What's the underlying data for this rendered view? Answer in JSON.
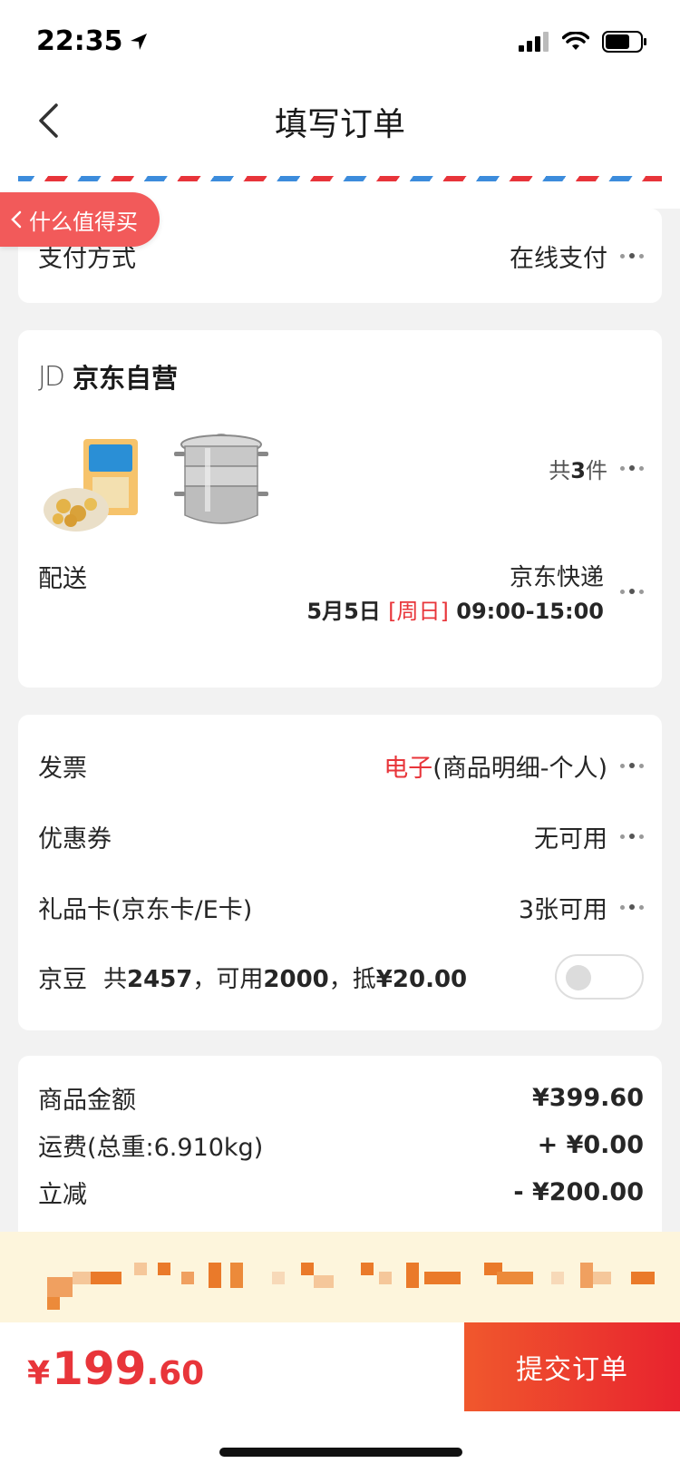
{
  "status_bar": {
    "time": "22:35"
  },
  "nav": {
    "title": "填写订单"
  },
  "floating_pill": {
    "label": "什么值得买"
  },
  "payment": {
    "label": "支付方式",
    "value": "在线支付"
  },
  "shop": {
    "logo_text": "JD",
    "name": "京东自营",
    "item_count_prefix": "共",
    "item_count": "3",
    "item_count_suffix": "件",
    "delivery_label": "配送",
    "carrier": "京东快递",
    "delivery_date": "5月5日",
    "delivery_weekday": "[周日]",
    "delivery_time": "09:00-15:00"
  },
  "invoice": {
    "label": "发票",
    "type": "电子",
    "detail": "(商品明细-个人)"
  },
  "coupon": {
    "label": "优惠券",
    "value": "无可用"
  },
  "gift_card": {
    "label": "礼品卡(京东卡/E卡)",
    "value": "3张可用"
  },
  "jingdou": {
    "label": "京豆",
    "total_prefix": "共",
    "total": "2457",
    "available_prefix": "，可用",
    "available": "2000",
    "deduct_prefix": "，抵",
    "deduct": "¥20.00",
    "enabled": false
  },
  "summary": {
    "goods_label": "商品金额",
    "goods_value": "¥399.60",
    "shipping_label": "运费(总重:6.910kg)",
    "shipping_value": "+ ¥0.00",
    "discount_label": "立减",
    "discount_value": "- ¥200.00"
  },
  "bottom": {
    "currency": "¥",
    "total_int": "199",
    "total_dec": ".60",
    "submit_label": "提交订单"
  },
  "colors": {
    "accent_red": "#e8353a",
    "pill_red": "#f25a5a",
    "banner_bg": "#fdf5dc"
  }
}
